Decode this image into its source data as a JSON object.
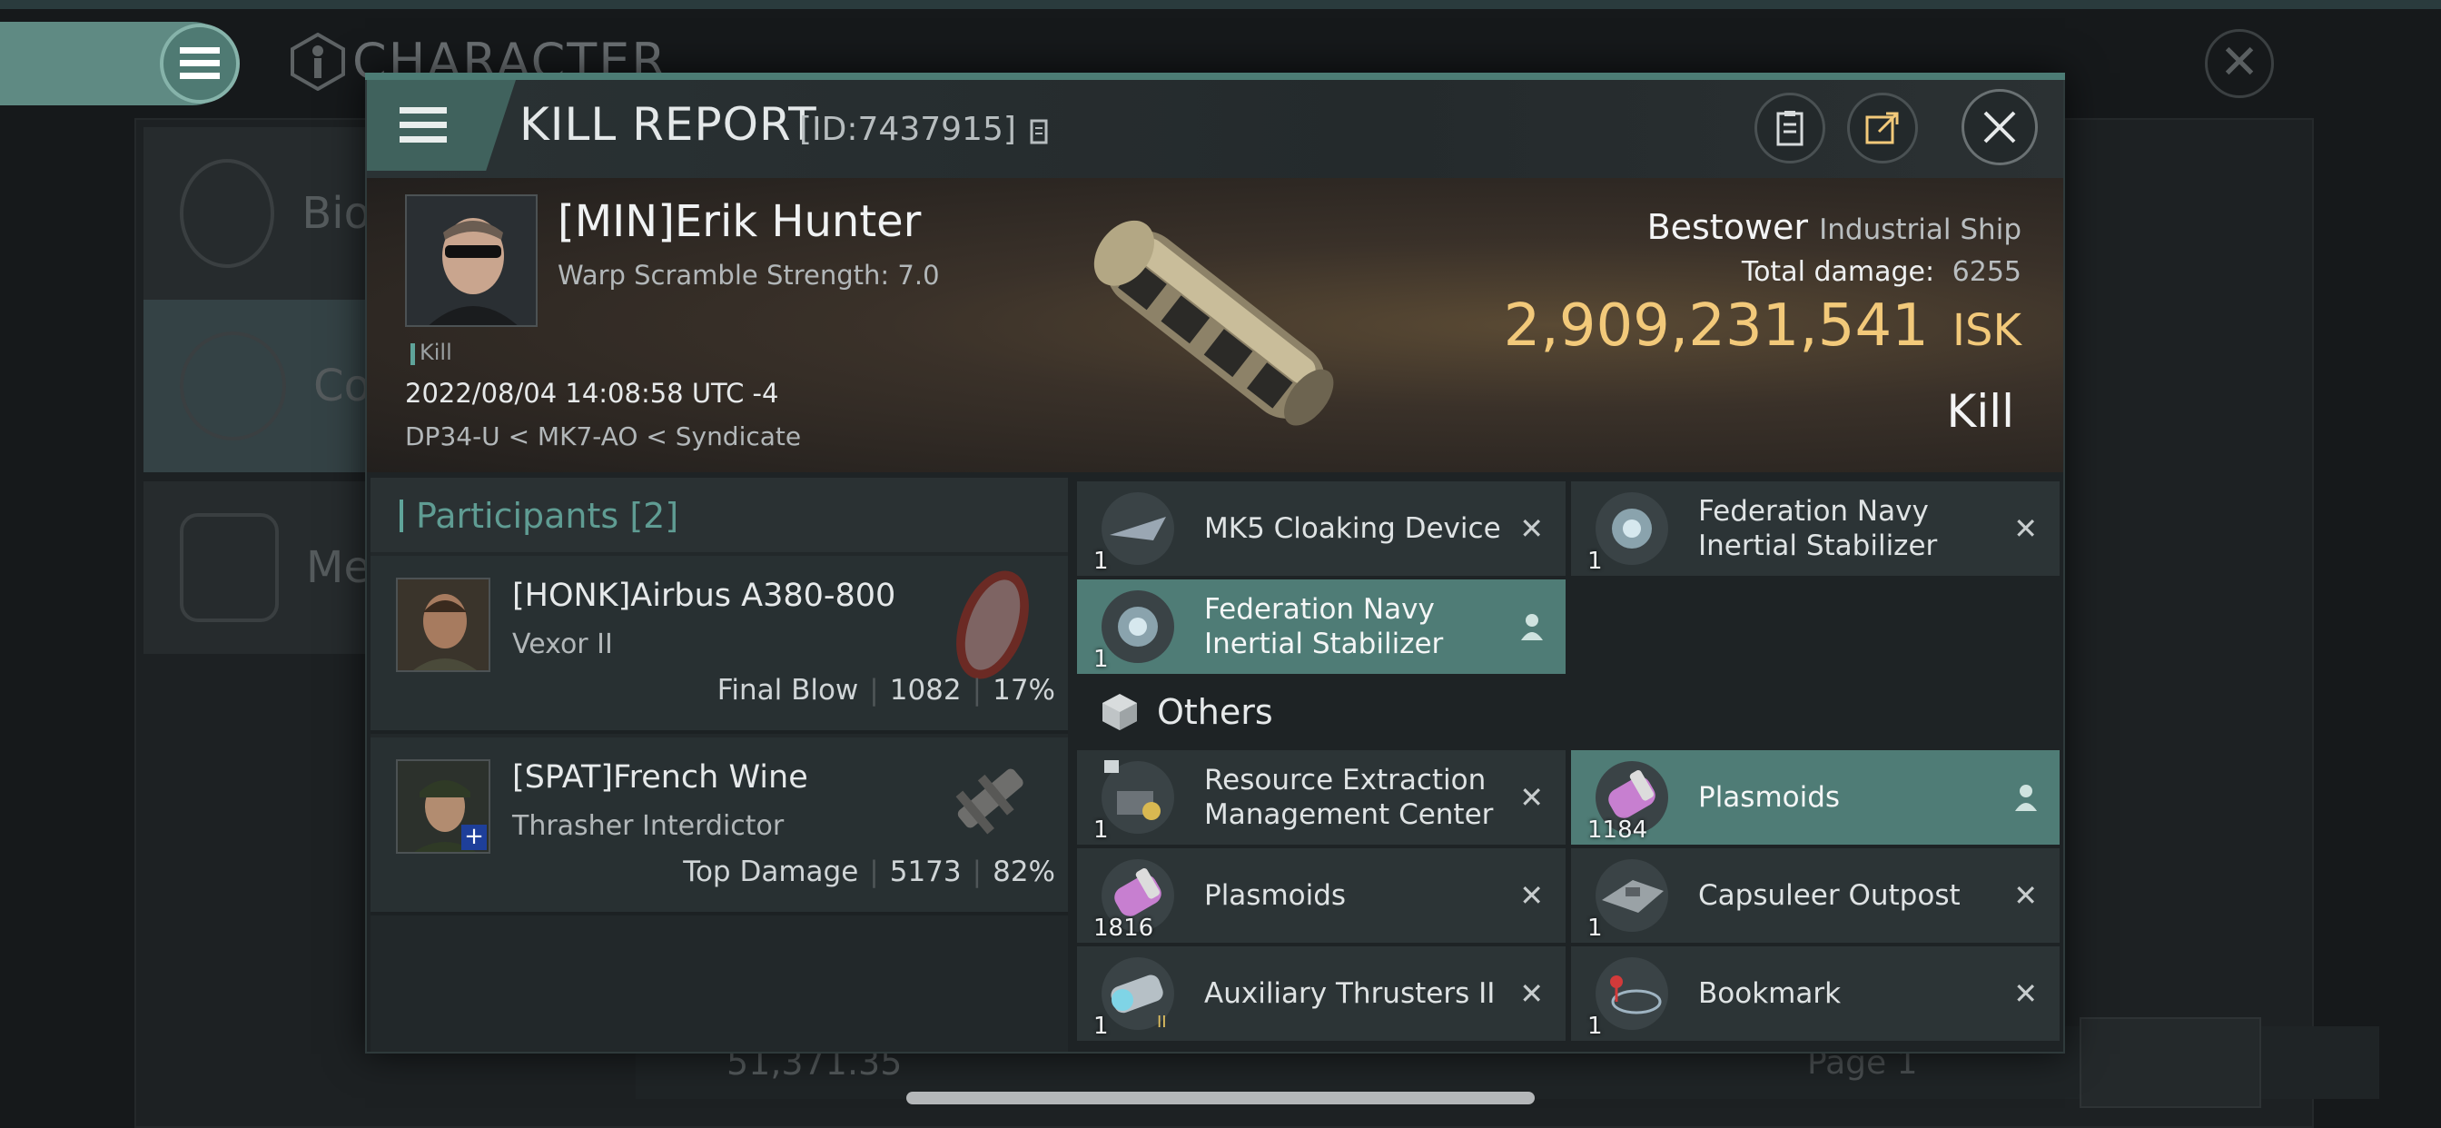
{
  "background": {
    "screen_title": "CHARACTER",
    "side_items": [
      "Bio",
      "Co",
      "Me"
    ],
    "isk_value": "51,371.35",
    "page_label": "Page 1"
  },
  "kill_report": {
    "title": "KILL REPORT",
    "id_label": "[ID:7437915]",
    "victim": {
      "name": "[MIN]Erik Hunter",
      "detail": "Warp Scramble Strength: 7.0",
      "tag": "Kill",
      "datetime": "2022/08/04 14:08:58 UTC -4",
      "location": "DP34-U < MK7-AO < Syndicate"
    },
    "ship": {
      "name": "Bestower",
      "class": "Industrial Ship",
      "damage_label": "Total damage:",
      "damage_value": "6255",
      "isk_value": "2,909,231,541",
      "isk_unit": "ISK",
      "result": "Kill"
    },
    "participants": {
      "title": "Participants",
      "count": "[2]",
      "items": [
        {
          "name": "[HONK]Airbus A380-800",
          "ship": "Vexor II",
          "role": "Final Blow",
          "damage": "1082",
          "percent": "17%"
        },
        {
          "name": "[SPAT]French Wine",
          "ship": "Thrasher Interdictor",
          "role": "Top Damage",
          "damage": "5173",
          "percent": "82%"
        }
      ]
    },
    "items": {
      "fitted": [
        {
          "label": "MK5 Cloaking Device",
          "qty": "1"
        },
        {
          "label": "Federation Navy\nInertial Stabilizer",
          "qty": "1"
        },
        {
          "label": "Federation Navy\nInertial Stabilizer",
          "qty": "1"
        }
      ],
      "others_title": "Others",
      "others": [
        {
          "label": "Resource Extraction\nManagement Center",
          "qty": "1"
        },
        {
          "label": "Plasmoids",
          "qty": "1184"
        },
        {
          "label": "Plasmoids",
          "qty": "1816"
        },
        {
          "label": "Capsuleer Outpost",
          "qty": "1"
        },
        {
          "label": "Auxiliary Thrusters II",
          "qty": "1"
        },
        {
          "label": "Bookmark",
          "qty": "1"
        }
      ]
    }
  },
  "colors": {
    "accent": "#5fa49a",
    "highlight": "#4f7c76",
    "isk": "#f2c97a"
  },
  "icons": [
    "menu-icon",
    "character-icon",
    "close-icon",
    "report-icon",
    "share-icon",
    "cube-icon",
    "person-icon"
  ]
}
